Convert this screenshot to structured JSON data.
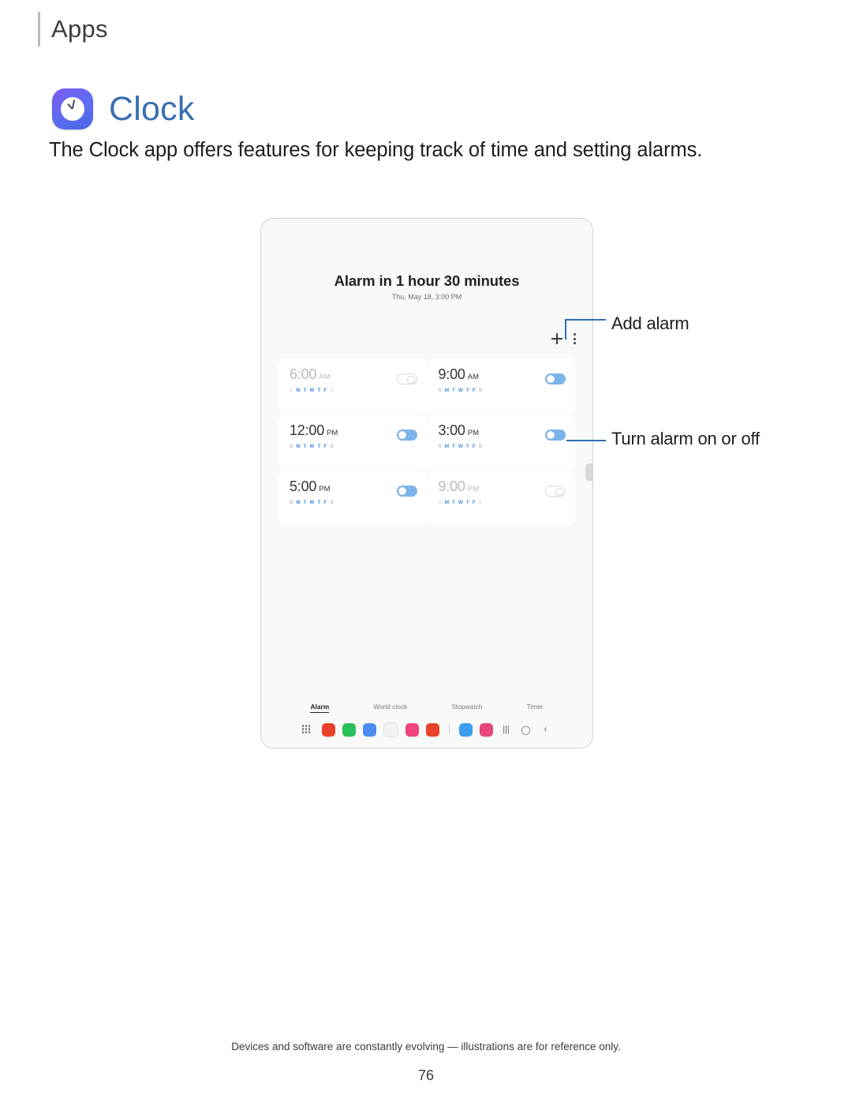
{
  "header": {
    "title": "Apps"
  },
  "section": {
    "icon": "clock-app-icon",
    "title": "Clock",
    "intro": "The Clock app offers features for keeping track of time and setting alarms."
  },
  "device": {
    "alarm_summary": "Alarm in 1 hour 30 minutes",
    "alarm_datetime": "Thu, May 18, 3:00 PM",
    "actions": {
      "add": "add-icon",
      "more": "more-options-icon"
    },
    "alarms": [
      {
        "time": "6:00",
        "ampm": "AM",
        "days": "S M T W T F S",
        "active_days": "M T W T F",
        "enabled": false
      },
      {
        "time": "9:00",
        "ampm": "AM",
        "days": "S M T W T F S",
        "active_days": "M T W T F",
        "enabled": true
      },
      {
        "time": "12:00",
        "ampm": "PM",
        "days": "S M T W T F S",
        "active_days": "M T W T F",
        "enabled": true
      },
      {
        "time": "3:00",
        "ampm": "PM",
        "days": "S M T W T F S",
        "active_days": "M T W T F",
        "enabled": true
      },
      {
        "time": "5:00",
        "ampm": "PM",
        "days": "S M T W T F S",
        "active_days": "M T W T F",
        "enabled": true
      },
      {
        "time": "9:00",
        "ampm": "PM",
        "days": "S M T W T F S",
        "active_days": "M T W T F",
        "enabled": false
      }
    ],
    "tabs": [
      {
        "label": "Alarm",
        "active": true
      },
      {
        "label": "World clock",
        "active": false
      },
      {
        "label": "Stopwatch",
        "active": false
      },
      {
        "label": "Timer",
        "active": false
      }
    ],
    "dock": {
      "apps_button": "all-apps-icon",
      "icons": [
        {
          "name": "youtube-icon",
          "color": "#e8402a"
        },
        {
          "name": "phone-icon",
          "color": "#2bbf5a"
        },
        {
          "name": "messages-icon",
          "color": "#4d8bf0"
        },
        {
          "name": "chrome-icon",
          "color": "#f2f4f5"
        },
        {
          "name": "photos-icon",
          "color": "#f0447c"
        },
        {
          "name": "play-store-icon",
          "color": "#e8402a"
        },
        {
          "name": "internet-icon",
          "color": "#3b9ef0"
        },
        {
          "name": "instagram-icon",
          "color": "#e8457c"
        }
      ],
      "nav": [
        {
          "name": "recents-button",
          "glyph": "|||"
        },
        {
          "name": "home-button",
          "glyph": "◯"
        },
        {
          "name": "back-button",
          "glyph": "‹"
        }
      ]
    }
  },
  "callouts": {
    "add_alarm": "Add alarm",
    "toggle_alarm": "Turn alarm on or off"
  },
  "footer": {
    "note": "Devices and software are constantly evolving — illustrations are for reference only.",
    "page_number": "76"
  }
}
